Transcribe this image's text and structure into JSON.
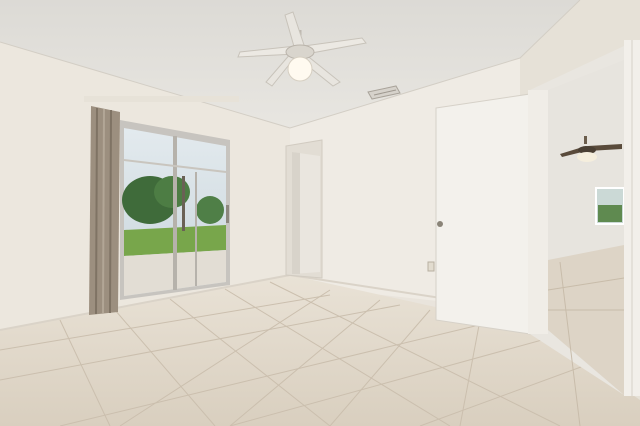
{
  "scene": {
    "type": "interior-photo",
    "room": "empty bedroom",
    "colors": {
      "wall": "#ece8e0",
      "wall_shadow": "#ddd7cd",
      "ceiling": "#e4e2dd",
      "floor": "#e2d9cb",
      "grout": "#cbbfae",
      "door": "#f4f2ee",
      "curtain": "#9e9282",
      "lawn": "#79a84c",
      "sky": "#d9e4ea",
      "foliage": "#3f6b3a"
    },
    "icons": [
      "ceiling-fan-icon",
      "air-vent-icon",
      "sliding-door-icon",
      "door-icon",
      "wall-outlet-icon"
    ]
  }
}
